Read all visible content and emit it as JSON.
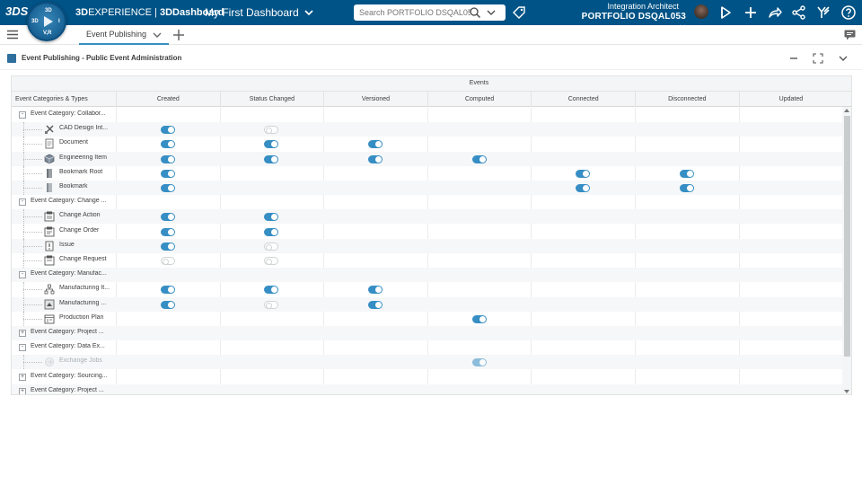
{
  "topbar": {
    "logo": "3DS",
    "brand_prefix": "3D",
    "brand_main": "EXPERIENCE | ",
    "brand_app": "3DDashboard",
    "dashboard_title": "My First Dashboard",
    "search_placeholder": "Search PORTFOLIO DSQAL053",
    "user_role": "Integration Architect",
    "user_context": "PORTFOLIO DSQAL053",
    "compass_labels": {
      "top": "3D",
      "left": "V,R",
      "right": "I"
    },
    "bg_color": "#005386"
  },
  "tabbar": {
    "active_tab": "Event Publishing"
  },
  "widget": {
    "title": "Event Publishing - Public Event Administration"
  },
  "grid": {
    "group_header": "Events",
    "first_col_header": "Event Categories & Types",
    "columns": [
      "Created",
      "Status Changed",
      "Versioned",
      "Computed",
      "Connected",
      "Disconnected",
      "Updated"
    ],
    "accent_color": "#368ec4",
    "rows": [
      {
        "kind": "category",
        "expanded": true,
        "label": "Event Category: Collabor..."
      },
      {
        "kind": "type",
        "icon": "cad-design-icon",
        "label": "CAD Design Int...",
        "toggles": [
          "on",
          "off",
          null,
          null,
          null,
          null,
          null
        ]
      },
      {
        "kind": "type",
        "icon": "document-icon",
        "label": "Document",
        "toggles": [
          "on",
          "on",
          "on",
          null,
          null,
          null,
          null
        ]
      },
      {
        "kind": "type",
        "icon": "engineering-item-icon",
        "label": "Engineering Item",
        "toggles": [
          "on",
          "on",
          "on",
          "on",
          null,
          null,
          null
        ]
      },
      {
        "kind": "type",
        "icon": "bookmark-root-icon",
        "label": "Bookmark Root",
        "toggles": [
          "on",
          null,
          null,
          null,
          "on",
          "on",
          null
        ]
      },
      {
        "kind": "type",
        "icon": "bookmark-icon",
        "label": "Bookmark",
        "toggles": [
          "on",
          null,
          null,
          null,
          "on",
          "on",
          null
        ]
      },
      {
        "kind": "category",
        "expanded": true,
        "label": "Event Category: Change ..."
      },
      {
        "kind": "type",
        "icon": "change-action-icon",
        "label": "Change Action",
        "toggles": [
          "on",
          "on",
          null,
          null,
          null,
          null,
          null
        ]
      },
      {
        "kind": "type",
        "icon": "change-order-icon",
        "label": "Change Order",
        "toggles": [
          "on",
          "on",
          null,
          null,
          null,
          null,
          null
        ]
      },
      {
        "kind": "type",
        "icon": "issue-icon",
        "label": "Issue",
        "toggles": [
          "on",
          "off",
          null,
          null,
          null,
          null,
          null
        ]
      },
      {
        "kind": "type",
        "icon": "change-request-icon",
        "label": "Change Request",
        "toggles": [
          "off",
          "off",
          null,
          null,
          null,
          null,
          null
        ]
      },
      {
        "kind": "category",
        "expanded": true,
        "label": "Event Category: Manufac..."
      },
      {
        "kind": "type",
        "icon": "manufacturing-item-icon",
        "label": "Manufacturing It...",
        "toggles": [
          "on",
          "on",
          "on",
          null,
          null,
          null,
          null
        ]
      },
      {
        "kind": "type",
        "icon": "manufacturing-icon",
        "label": "Manufacturing ...",
        "toggles": [
          "on",
          "off",
          "on",
          null,
          null,
          null,
          null
        ]
      },
      {
        "kind": "type",
        "icon": "production-plan-icon",
        "label": "Production Plan",
        "toggles": [
          null,
          null,
          null,
          "on",
          null,
          null,
          null
        ]
      },
      {
        "kind": "category",
        "expanded": false,
        "label": "Event Category: Project ..."
      },
      {
        "kind": "category",
        "expanded": true,
        "label": "Event Category: Data Ex..."
      },
      {
        "kind": "type",
        "icon": "exchange-jobs-icon",
        "label": "Exchange Jobs",
        "dim": true,
        "toggles": [
          null,
          null,
          null,
          "faded",
          null,
          null,
          null
        ]
      },
      {
        "kind": "category",
        "expanded": false,
        "label": "Event Category: Sourcing..."
      },
      {
        "kind": "category",
        "expanded": false,
        "label": "Event Category: Project ..."
      }
    ]
  }
}
